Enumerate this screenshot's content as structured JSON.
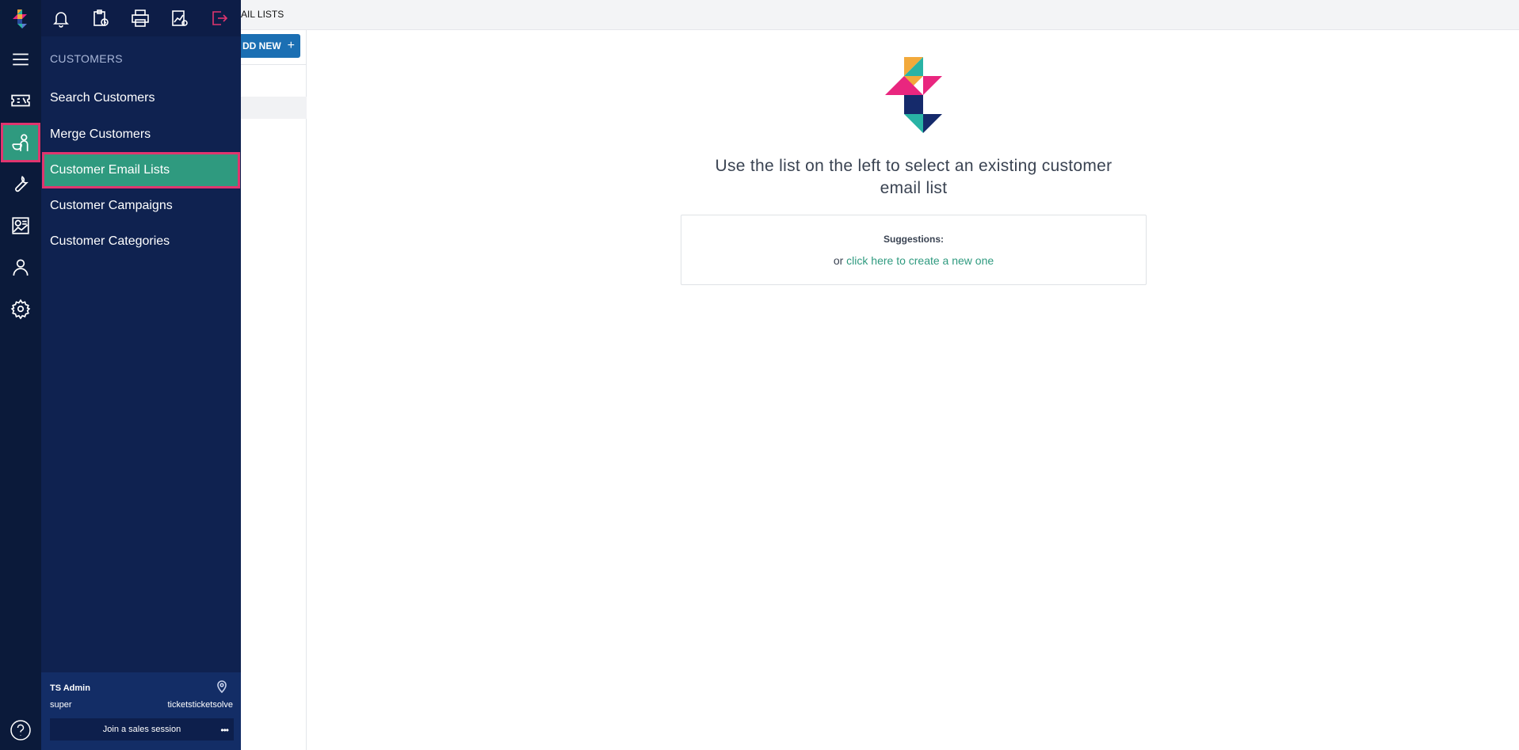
{
  "topbar": {
    "title_fragment": "AIL LISTS"
  },
  "list_panel": {
    "add_new_label": "DD NEW",
    "add_new_icon": "plus-icon"
  },
  "rail": {
    "items": [
      {
        "name": "menu-icon"
      },
      {
        "name": "ticket-icon"
      },
      {
        "name": "customers-icon",
        "active": true
      },
      {
        "name": "wrench-icon"
      },
      {
        "name": "reports-icon"
      },
      {
        "name": "user-icon"
      },
      {
        "name": "gear-icon"
      }
    ],
    "help_icon": "help-icon"
  },
  "flyout": {
    "top_icons": [
      "bell-icon",
      "clipboard-clock-icon",
      "printer-icon",
      "chart-icon",
      "logout-icon"
    ],
    "heading": "CUSTOMERS",
    "items": [
      {
        "label": "Search Customers"
      },
      {
        "label": "Merge Customers"
      },
      {
        "label": "Customer Email Lists",
        "active": true
      },
      {
        "label": "Customer Campaigns"
      },
      {
        "label": "Customer Categories"
      }
    ],
    "user": {
      "name": "TS Admin",
      "role": "super",
      "org": "ticketsticketsolve",
      "sales_session_label": "Join a sales session",
      "more_label": "•••"
    }
  },
  "main": {
    "empty_message": "Use the list on the left to select an existing customer email list",
    "suggestions_title": "Suggestions:",
    "suggestion_prefix": "or",
    "suggestion_link": "click here to create a new one"
  },
  "colors": {
    "rail_bg": "#0b1a3a",
    "flyout_bg": "#0f2250",
    "accent_green": "#2f9a7f",
    "highlight_pink": "#e0356f",
    "button_blue": "#1b6fb3"
  }
}
